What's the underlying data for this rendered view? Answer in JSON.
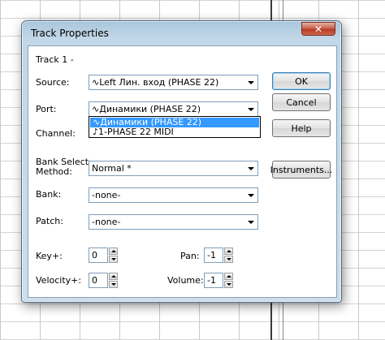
{
  "dialog": {
    "title": "Track Properties",
    "close_glyph": "✕",
    "track_label": "Track 1 -"
  },
  "source": {
    "label": "Source:",
    "value": "Left Лин. вход (PHASE 22)",
    "icon": "wave-icon"
  },
  "port": {
    "label": "Port:",
    "value": "Динамики (PHASE 22)",
    "icon": "wave-icon",
    "options": [
      {
        "icon_glyph": "∿",
        "label": "Динамики (PHASE 22)",
        "selected": true
      },
      {
        "icon_glyph": "♪",
        "label": "1-PHASE 22 MIDI",
        "selected": false
      }
    ]
  },
  "channel": {
    "label": "Channel:"
  },
  "bank_select": {
    "label_line1": "Bank Select",
    "label_line2": "Method:",
    "value": "Normal  *"
  },
  "bank": {
    "label": "Bank:",
    "value": "-none-"
  },
  "patch": {
    "label": "Patch:",
    "value": "-none-"
  },
  "key_plus": {
    "label": "Key+:",
    "value": "0"
  },
  "velocity_plus": {
    "label": "Velocity+:",
    "value": "0"
  },
  "pan": {
    "label": "Pan:",
    "value": "-1"
  },
  "volume": {
    "label": "Volume:",
    "value": "-1"
  },
  "buttons": {
    "ok": "OK",
    "cancel": "Cancel",
    "help": "Help",
    "instruments": "Instruments..."
  },
  "wave_glyph": "∿"
}
